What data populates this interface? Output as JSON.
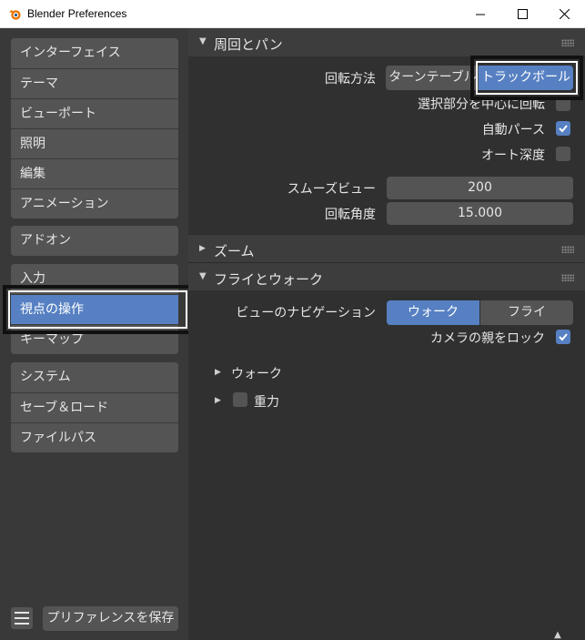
{
  "window": {
    "title": "Blender Preferences",
    "min": "—",
    "max": "☐",
    "close": "✕"
  },
  "sidebar": {
    "group1": [
      "インターフェイス",
      "テーマ",
      "ビューポート",
      "照明",
      "編集",
      "アニメーション"
    ],
    "group2": [
      "アドオン"
    ],
    "group3": [
      "入力",
      "視点の操作",
      "キーマップ"
    ],
    "group4": [
      "システム",
      "セーブ＆ロード",
      "ファイルパス"
    ],
    "active": "視点の操作",
    "save_label": "プリファレンスを保存"
  },
  "orbit_pan": {
    "title": "周回とパン",
    "orbit_method_label": "回転方法",
    "orbit_options": [
      "ターンテーブル",
      "トラックボール"
    ],
    "selected_orbit": "トラックボール",
    "orbit_around_selection": "選択部分を中心に回転",
    "orbit_around_selection_checked": false,
    "auto_perspective": "自動パース",
    "auto_perspective_checked": true,
    "auto_depth": "オート深度",
    "auto_depth_checked": false,
    "smooth_view_label": "スムーズビュー",
    "smooth_view_value": "200",
    "rotation_angle_label": "回転角度",
    "rotation_angle_value": "15.000"
  },
  "zoom": {
    "title": "ズーム"
  },
  "fly_walk": {
    "title": "フライとウォーク",
    "view_nav_label": "ビューのナビゲーション",
    "nav_options": [
      "ウォーク",
      "フライ"
    ],
    "selected_nav": "ウォーク",
    "lock_camera_parent": "カメラの親をロック",
    "lock_camera_parent_checked": true,
    "walk_label": "ウォーク",
    "gravity_label": "重力",
    "gravity_checked": false
  },
  "colors": {
    "accent": "#5680c2",
    "panel": "#3d3d3d",
    "widget": "#545454",
    "bg": "#393939"
  }
}
